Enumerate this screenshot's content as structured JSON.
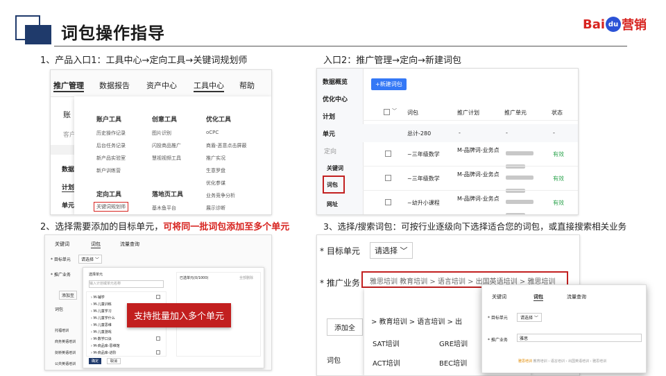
{
  "header": {
    "title": "词包操作指导",
    "logo_bai": "Bai",
    "logo_du": "du",
    "logo_ying": "营销"
  },
  "steps": {
    "s1": "1、产品入口1：工具中心→定向工具→关键词规划师",
    "s2": "入口2：推广管理→定向→新建词包",
    "s3_prefix": "2、选择需要添加的目标单元，",
    "s3_highlight": "可将同一批词包添加至多个单元",
    "s4": "3、选择/搜索词包：可按行业逐级向下选择适合您的词包，或直接搜索相关业务"
  },
  "shot1": {
    "nav": [
      "推广管理",
      "数据报告",
      "资产中心",
      "工具中心",
      "帮助"
    ],
    "left_frag": [
      "账",
      "客户",
      "数据",
      "计划",
      "单元"
    ],
    "col1_title": "账户工具",
    "col1_items": [
      "历史操作记录",
      "后台任务记录",
      "新产品实验室",
      "新户训练营"
    ],
    "col1b_title": "定向工具",
    "col1b_items": [
      "关键词规划师"
    ],
    "col2_title": "创意工具",
    "col2_items": [
      "图片识别",
      "闪投商品推广",
      "慧视视频工具"
    ],
    "col2b_title": "落地页工具",
    "col2b_items": [
      "基木鱼平台"
    ],
    "col3_title": "优化工具",
    "col3_items": [
      "oCPC",
      "商盾-恶意点击屏蔽",
      "推广实况",
      "生意罗盘",
      "优化参谋",
      "业务竞争分析",
      "展示诊断"
    ]
  },
  "shot2": {
    "sidebar": [
      "数据概览",
      "优化中心",
      "计划",
      "单元",
      "定向",
      "关键词",
      "词包",
      "网址"
    ],
    "new_btn": "+新建词包",
    "cols": [
      "词包",
      "推广计划",
      "推广单元",
      "状态"
    ],
    "total_row": [
      "总计-280",
      "-",
      "-",
      "-"
    ],
    "rows": [
      {
        "name": "~三年级数学",
        "plan": "M-品牌词-业务点",
        "status": "有效"
      },
      {
        "name": "~三年级数学",
        "plan": "M-品牌词-业务点",
        "status": "有效"
      },
      {
        "name": "~幼升小课程",
        "plan": "M-品牌词-业务点",
        "status": "有效"
      }
    ]
  },
  "shot3": {
    "tabs": [
      "关键词",
      "词包",
      "流量查询"
    ],
    "target_label": "* 目标单元",
    "target_select": "请选择",
    "biz_label": "* 推广业务",
    "panel_title": "选择单元",
    "panel_search": "输入计划或单元名称",
    "items": [
      "M-辅学",
      "M-儿童训练",
      "M-儿童学习",
      "M-儿童学什么",
      "M-儿童思维",
      "M-儿童游戏",
      "M-数学口诀",
      "M-商品库-思维馆",
      "M-商品库-进阶"
    ],
    "right_title": "已选单元(0/1000)",
    "right_clear": "全部删除",
    "left_frag": [
      "添加至",
      "词包",
      "托福培训",
      "商务英语培训",
      "剑桥英语培训",
      "公共英语培训"
    ],
    "confirm": "确定",
    "cancel": "取消",
    "overlay": "支持批量加入多个单元"
  },
  "shot4": {
    "target_label": "* 目标单元",
    "target_select": "请选择",
    "biz_label": "* 推广业务",
    "breadcrumb": "雅思培训  教育培训 > 语言培训 > 出国英语培训 > 雅思培训",
    "add_btn": "添加全",
    "cat_path": "> 教育培训   >  语言培训   >  出",
    "grid": [
      "SAT培训",
      "GRE培训",
      "ACT培训",
      "BEC培训"
    ],
    "bottom_label": "词包"
  },
  "shot5": {
    "tabs": [
      "关键词",
      "词包",
      "流量查询"
    ],
    "target_label": "* 目标单元",
    "target_select": "请选择",
    "biz_label": "* 推广业务",
    "search_value": "雅思",
    "suggest_hl": "雅思培训",
    "suggest_rest": "  教育培训 › 语言培训 › 出国英语培训 › 雅思培训"
  }
}
